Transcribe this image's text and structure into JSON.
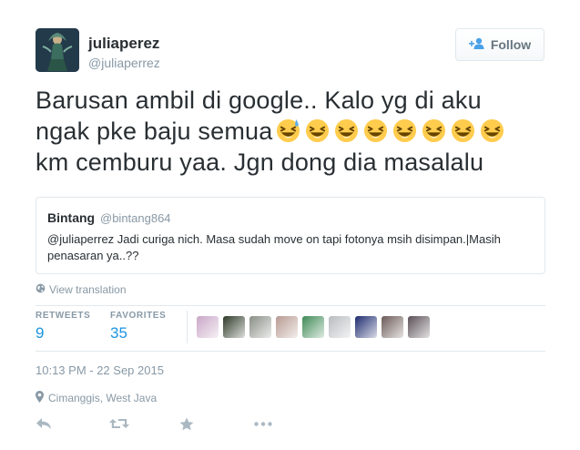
{
  "author": {
    "name": "juliaperez",
    "handle": "@juliaperrez"
  },
  "follow_button": {
    "label": "Follow"
  },
  "tweet": {
    "line1": "Barusan ambil di google.. Kalo yg di aku",
    "line2": "ngak pke baju semua",
    "line3": "km cemburu yaa. Jgn dong dia masalalu",
    "emojis": [
      "sweat-smile-emoji",
      "laughing-emoji",
      "laughing-emoji",
      "laughing-emoji",
      "laughing-emoji",
      "laughing-emoji",
      "laughing-emoji",
      "laughing-emoji"
    ]
  },
  "quote": {
    "name": "Bintang",
    "handle": "@bintang864",
    "text": "@juliaperrez Jadi curiga nich. Masa sudah move on tapi fotonya msih disimpan.|Masih penasaran ya..??"
  },
  "view_translation": "View translation",
  "stats": {
    "retweets_label": "RETWEETS",
    "retweets_value": "9",
    "favorites_label": "FAVORITES",
    "favorites_value": "35"
  },
  "favoriters": [
    "#c9a7c7",
    "#2e3a28",
    "#8a8f86",
    "#b89a92",
    "#3f8a55",
    "#b9bcc0",
    "#1d2b6e",
    "#6b5a57",
    "#5a4f55"
  ],
  "timestamp": "10:13 PM - 22 Sep 2015",
  "location": "Cimanggis, West Java",
  "colors": {
    "link": "#1b95e0",
    "muted": "#8899a6",
    "text": "#292f33",
    "border": "#e1e8ed"
  }
}
